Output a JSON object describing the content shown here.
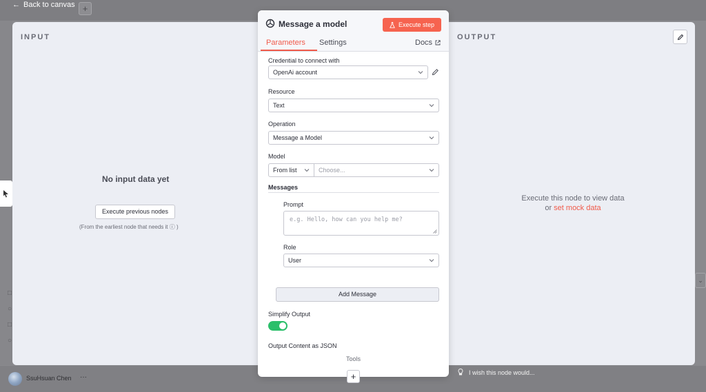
{
  "topbar": {
    "back_label": "Back to canvas",
    "add_label": "+"
  },
  "input_pane": {
    "title": "INPUT",
    "empty_message": "No input data yet",
    "execute_previous_label": "Execute previous nodes",
    "hint": "(From the earliest node that needs it ⓘ )"
  },
  "output_pane": {
    "title": "OUTPUT",
    "empty_message_line1": "Execute this node to view data",
    "empty_message_or": "or",
    "mock_link": "set mock data"
  },
  "node": {
    "title": "Message a model",
    "execute_label": "Execute step",
    "tabs": {
      "parameters": "Parameters",
      "settings": "Settings",
      "docs": "Docs"
    },
    "fields": {
      "credential_label": "Credential to connect with",
      "credential_value": "OpenAi account",
      "resource_label": "Resource",
      "resource_value": "Text",
      "operation_label": "Operation",
      "operation_value": "Message a Model",
      "model_label": "Model",
      "model_mode": "From list",
      "model_placeholder": "Choose...",
      "messages_label": "Messages",
      "prompt_label": "Prompt",
      "prompt_placeholder": "e.g. Hello, how can you help me?",
      "role_label": "Role",
      "role_value": "User",
      "add_message_label": "Add Message",
      "simplify_label": "Simplify Output",
      "simplify_enabled": true,
      "json_label": "Output Content as JSON",
      "tools_label": "Tools"
    }
  },
  "footer": {
    "user_name": "SsuHsuan Chen",
    "user_more": "···",
    "wish_text": "I wish this node would...",
    "add_label": "+"
  },
  "colors": {
    "accent": "#f05a4a",
    "toggle_on": "#2bbf6a",
    "execute_bg": "#f6634f"
  }
}
